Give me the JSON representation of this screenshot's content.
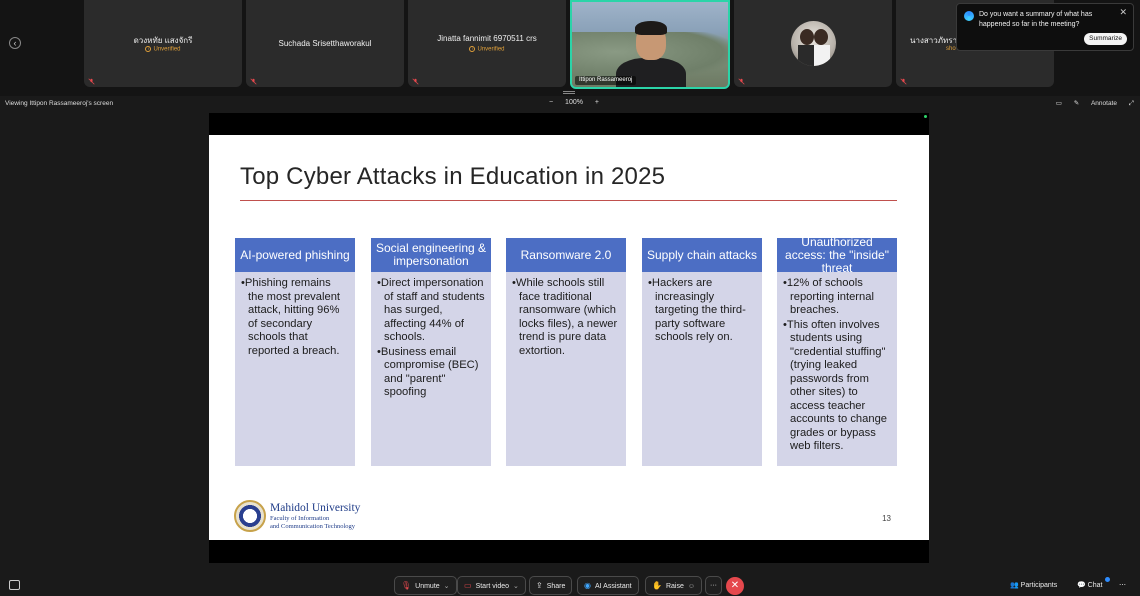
{
  "gallery": {
    "tiles": [
      {
        "name": "ดวงหทัย แสงจักรี",
        "status": "Unverified"
      },
      {
        "name": "Suchada Srisetthaworakul",
        "status": ""
      },
      {
        "name": "Jinatta fannimit 6970511 crs",
        "status": "Unverified"
      },
      {
        "name": "Ittipon Rassameeroj",
        "status": ""
      },
      {
        "name": "",
        "status": ""
      },
      {
        "name": "นางสาวภัทรา",
        "status": "sho"
      }
    ]
  },
  "toast": {
    "message": "Do you want a summary of what has happened so far in the meeting?",
    "button": "Summarize"
  },
  "viewbar": {
    "label": "Viewing Ittipon Rassameeroj's screen",
    "zoom_minus": "−",
    "zoom_level": "100%",
    "zoom_plus": "+",
    "annotate": "Annotate"
  },
  "slide": {
    "title": "Top Cyber Attacks in Education in 2025",
    "columns": [
      {
        "heading": "AI-powered phishing",
        "bullets": [
          "Phishing remains the most prevalent attack, hitting 96% of secondary schools that reported a breach."
        ]
      },
      {
        "heading": "Social engineering & impersonation",
        "bullets": [
          "Direct impersonation of staff and students has surged, affecting 44% of schools.",
          "Business email compromise (BEC) and \"parent\" spoofing"
        ]
      },
      {
        "heading": "Ransomware 2.0",
        "bullets": [
          "While schools still face traditional ransomware (which locks files), a newer trend is pure data extortion."
        ]
      },
      {
        "heading": "Supply chain attacks",
        "bullets": [
          "Hackers are increasingly targeting the third-party software schools rely on."
        ]
      },
      {
        "heading": "Unauthorized access: the \"inside\" threat",
        "bullets": [
          "12% of schools reporting internal breaches.",
          "This often involves students using \"credential stuffing\" (trying leaked passwords from other sites) to access teacher accounts to change grades or bypass web filters."
        ]
      }
    ],
    "logo": {
      "university": "Mahidol University",
      "faculty_line1": "Faculty of Information",
      "faculty_line2": "and Communication Technology"
    },
    "page_number": "13"
  },
  "toolbar": {
    "unmute": "Unmute",
    "start_video": "Start video",
    "share": "Share",
    "ai_assistant": "AI Assistant",
    "raise": "Raise",
    "more": "···",
    "participants": "Participants",
    "chat": "Chat"
  },
  "colors": {
    "accent": "#2bd4a8",
    "slide_header": "#4c6ec4",
    "slide_body": "#d4d5e8",
    "title_rule": "#c0504d",
    "end_button": "#e5484d"
  }
}
